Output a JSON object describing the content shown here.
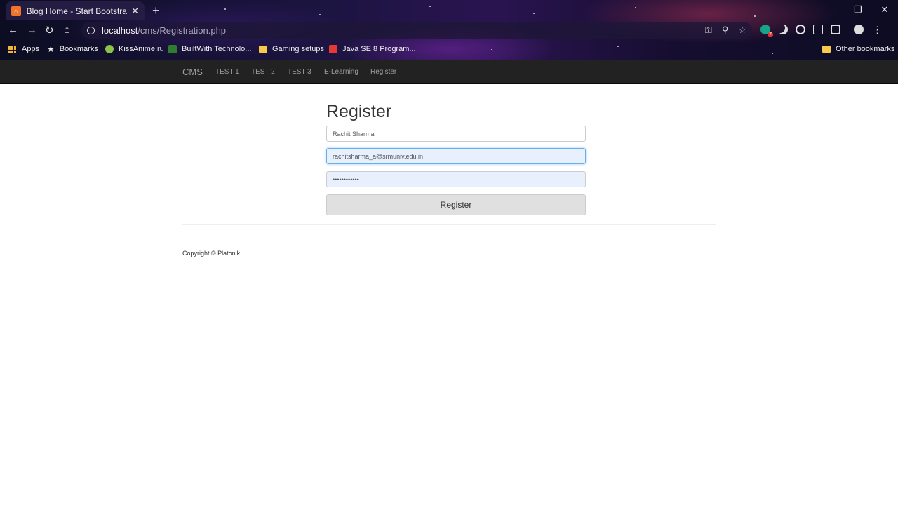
{
  "browser": {
    "tab_title": "Blog Home - Start Bootstrap Tem",
    "url_host": "localhost",
    "url_path": "/cms/Registration.php",
    "bookmarks": {
      "apps": "Apps",
      "bookmarks": "Bookmarks",
      "kissanime": "KissAnime.ru",
      "builtwith": "BuiltWith Technolo...",
      "gaming": "Gaming setups",
      "java": "Java SE 8 Program...",
      "other": "Other bookmarks"
    },
    "extension_badge": "7"
  },
  "navbar": {
    "brand": "CMS",
    "links": [
      "TEST 1",
      "TEST 2",
      "TEST 3",
      "E-Learning",
      "Register"
    ]
  },
  "form": {
    "title": "Register",
    "name_value": "Rachit Sharma",
    "email_value": "rachitsharma_a@srmuniv.edu.in",
    "password_masked": "••••••••••••",
    "submit_label": "Register"
  },
  "footer": {
    "copyright": "Copyright © Platonik"
  }
}
